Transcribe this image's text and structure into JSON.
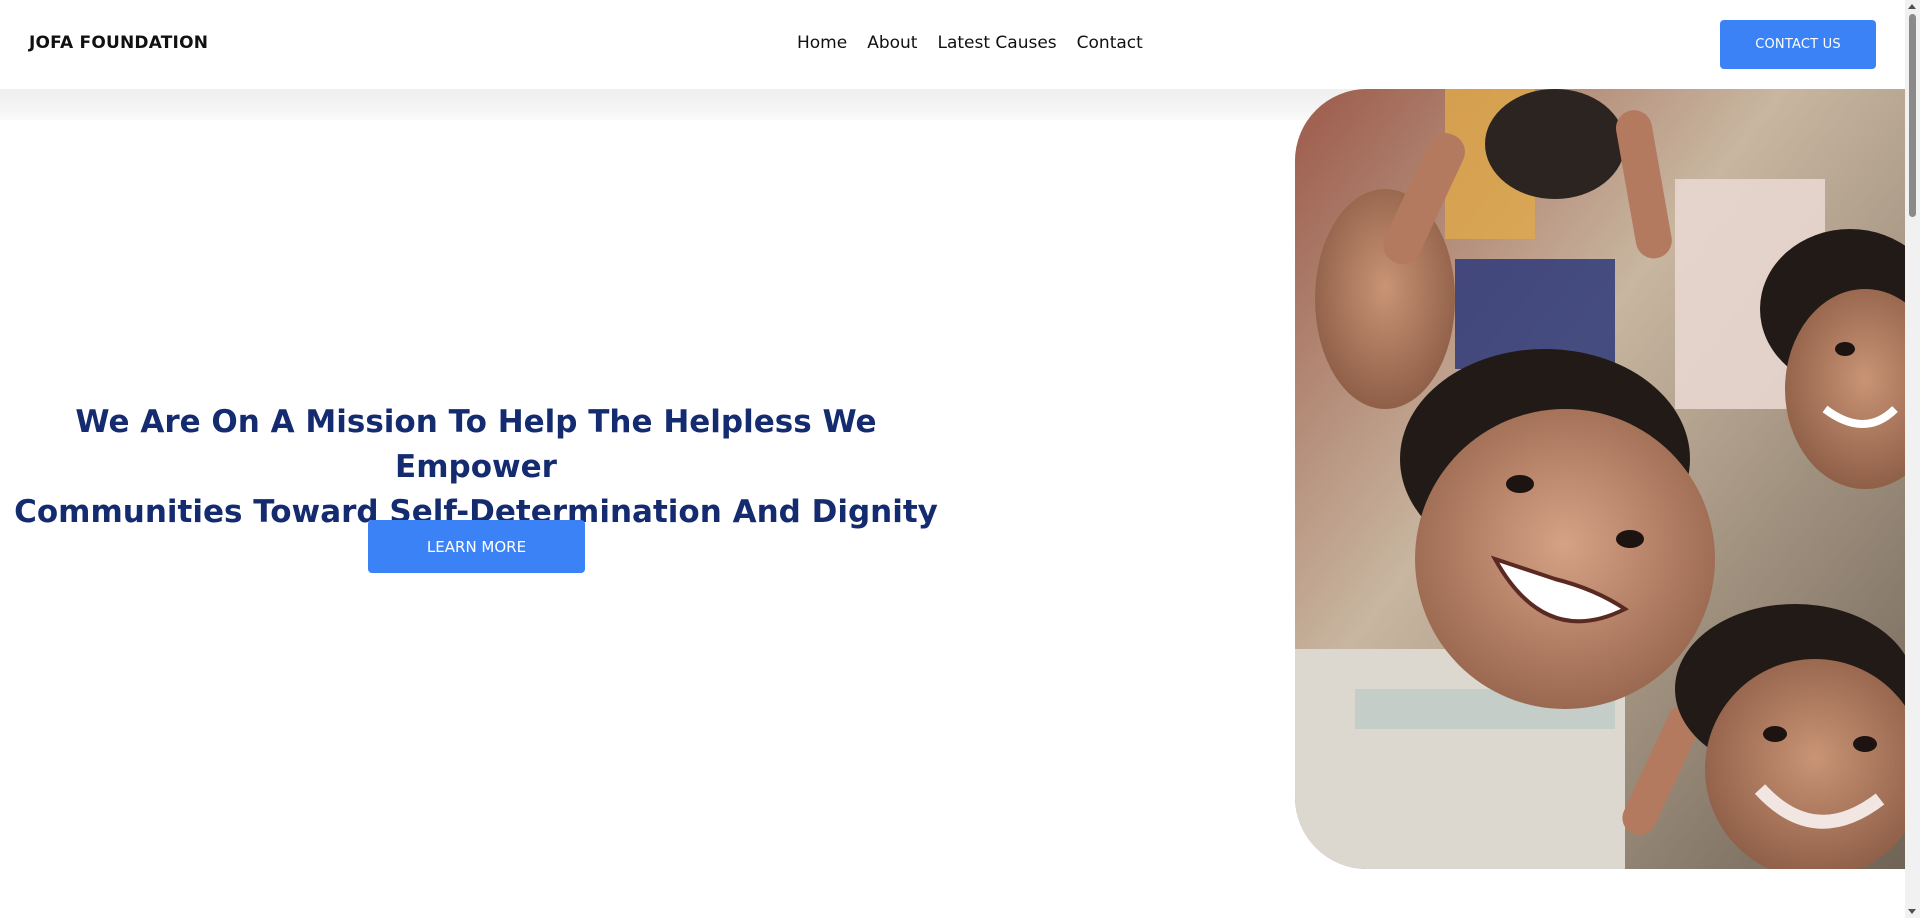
{
  "header": {
    "brand": "JOFA FOUNDATION",
    "nav": [
      "Home",
      "About",
      "Latest Causes",
      "Contact"
    ],
    "cta_label": "CONTACT US"
  },
  "hero": {
    "headline_line1": "We Are On A Mission To Help The Helpless We Empower",
    "headline_line2": "Communities Toward Self-Determination And Dignity",
    "button_label": "LEARN MORE"
  },
  "colors": {
    "accent": "#3b82f6",
    "headline": "#142b6f"
  }
}
